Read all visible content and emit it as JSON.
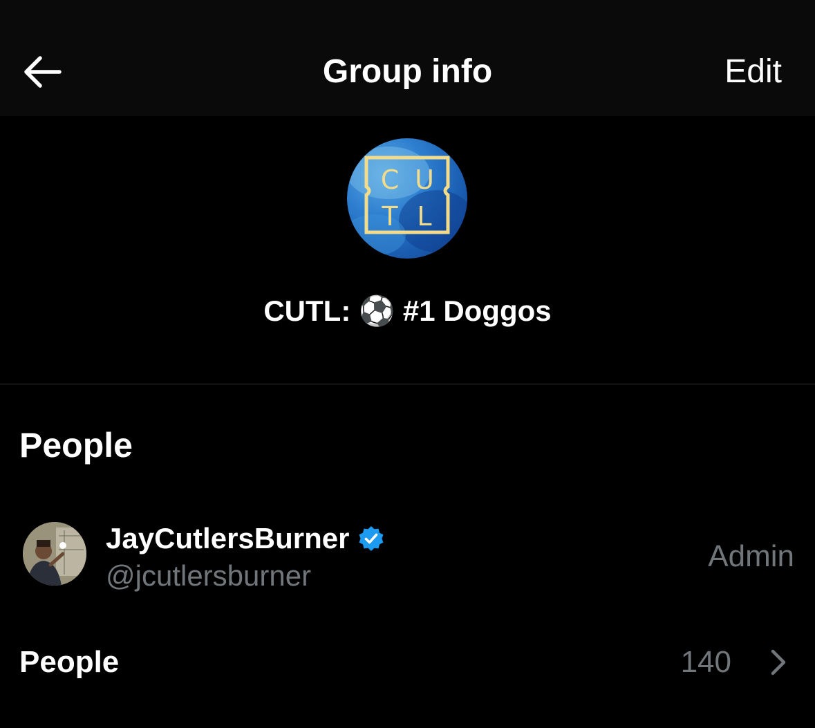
{
  "header": {
    "title": "Group info",
    "edit_label": "Edit",
    "back_icon": "arrow-left-icon"
  },
  "group": {
    "avatar_text": [
      "C",
      "U",
      "T",
      "L"
    ],
    "name": "CUTL: ⚽ #1 Doggos"
  },
  "people_section": {
    "title": "People",
    "members": [
      {
        "name": "JayCutlersBurner",
        "handle": "@jcutlersburner",
        "role": "Admin",
        "verified": true
      }
    ],
    "all_people_label": "People",
    "all_people_count": "140",
    "chevron_icon": "chevron-right-icon"
  },
  "colors": {
    "background": "#000000",
    "header_background": "#0a0a0a",
    "primary_text": "#ffffff",
    "secondary_text": "#71767b",
    "divider": "#2f3336",
    "verified_blue": "#1d9bf0",
    "logo_gold": "#f2dc8c"
  }
}
